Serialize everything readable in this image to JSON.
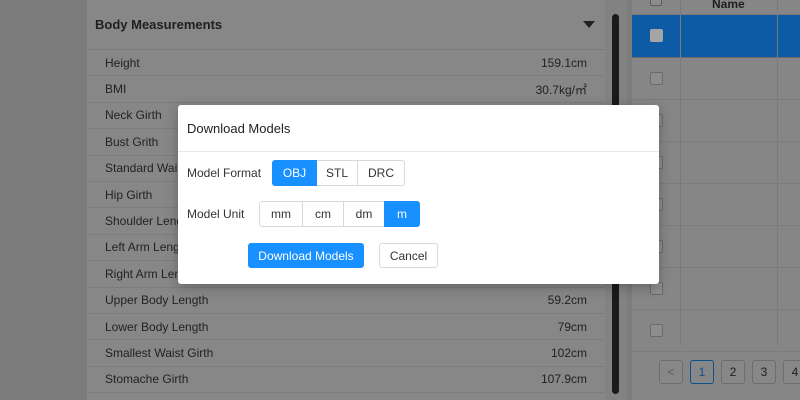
{
  "measurements": {
    "title": "Body Measurements",
    "rows": [
      {
        "label": "Height",
        "value": "159.1cm"
      },
      {
        "label": "BMI",
        "value": "30.7kg/㎡"
      },
      {
        "label": "Neck Girth",
        "value": ""
      },
      {
        "label": "Bust Grith",
        "value": ""
      },
      {
        "label": "Standard Waist",
        "value": ""
      },
      {
        "label": "Hip Girth",
        "value": ""
      },
      {
        "label": "Shoulder Leng",
        "value": ""
      },
      {
        "label": "Left Arm Lengt",
        "value": ""
      },
      {
        "label": "Right Arm Len",
        "value": ""
      },
      {
        "label": "Upper Body Length",
        "value": "59.2cm"
      },
      {
        "label": "Lower Body Length",
        "value": "79cm"
      },
      {
        "label": "Smallest Waist Girth",
        "value": "102cm"
      },
      {
        "label": "Stomache Girth",
        "value": "107.9cm"
      }
    ]
  },
  "table": {
    "column_name": "Name",
    "pages": [
      "1",
      "2",
      "3",
      "4"
    ],
    "prev_label": "<"
  },
  "modal": {
    "title": "Download Models",
    "format": {
      "label": "Model Format",
      "options": [
        "OBJ",
        "STL",
        "DRC"
      ],
      "selected": "OBJ"
    },
    "unit": {
      "label": "Model Unit",
      "options": [
        "mm",
        "cm",
        "dm",
        "m"
      ],
      "selected": "m"
    },
    "download_label": "Download Models",
    "cancel_label": "Cancel"
  },
  "colors": {
    "primary": "#1890ff",
    "overlay": "#808080",
    "selected_row": "#0d5aa5"
  }
}
